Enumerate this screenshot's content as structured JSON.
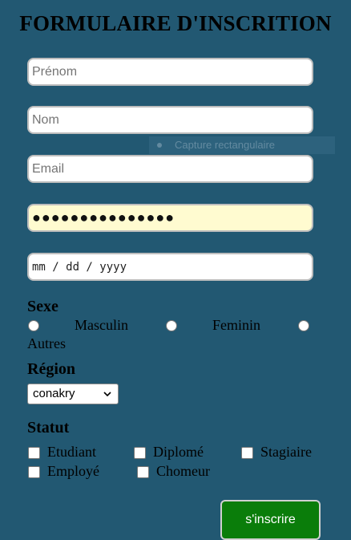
{
  "form": {
    "title": "FORMULAIRE D'INSCRITION",
    "prenom_placeholder": "Prénom",
    "nom_placeholder": "Nom",
    "email_placeholder": "Email",
    "password_value": "●●●●●●●●●●●●●●●",
    "date_placeholder": "mm / dd / yyyy"
  },
  "overlay": {
    "label": "Capture rectangulaire"
  },
  "sexe": {
    "label": "Sexe",
    "options": [
      "Masculin",
      "Feminin",
      "Autres"
    ]
  },
  "region": {
    "label": "Région",
    "selected": "conakry"
  },
  "statut": {
    "label": "Statut",
    "options": [
      "Etudiant",
      "Diplomé",
      "Stagiaire",
      "Employé",
      "Chomeur"
    ]
  },
  "submit_label": "s'inscrire",
  "colors": {
    "background": "#225872",
    "button": "#0a7d0a",
    "password_bg": "#fffbd0"
  }
}
